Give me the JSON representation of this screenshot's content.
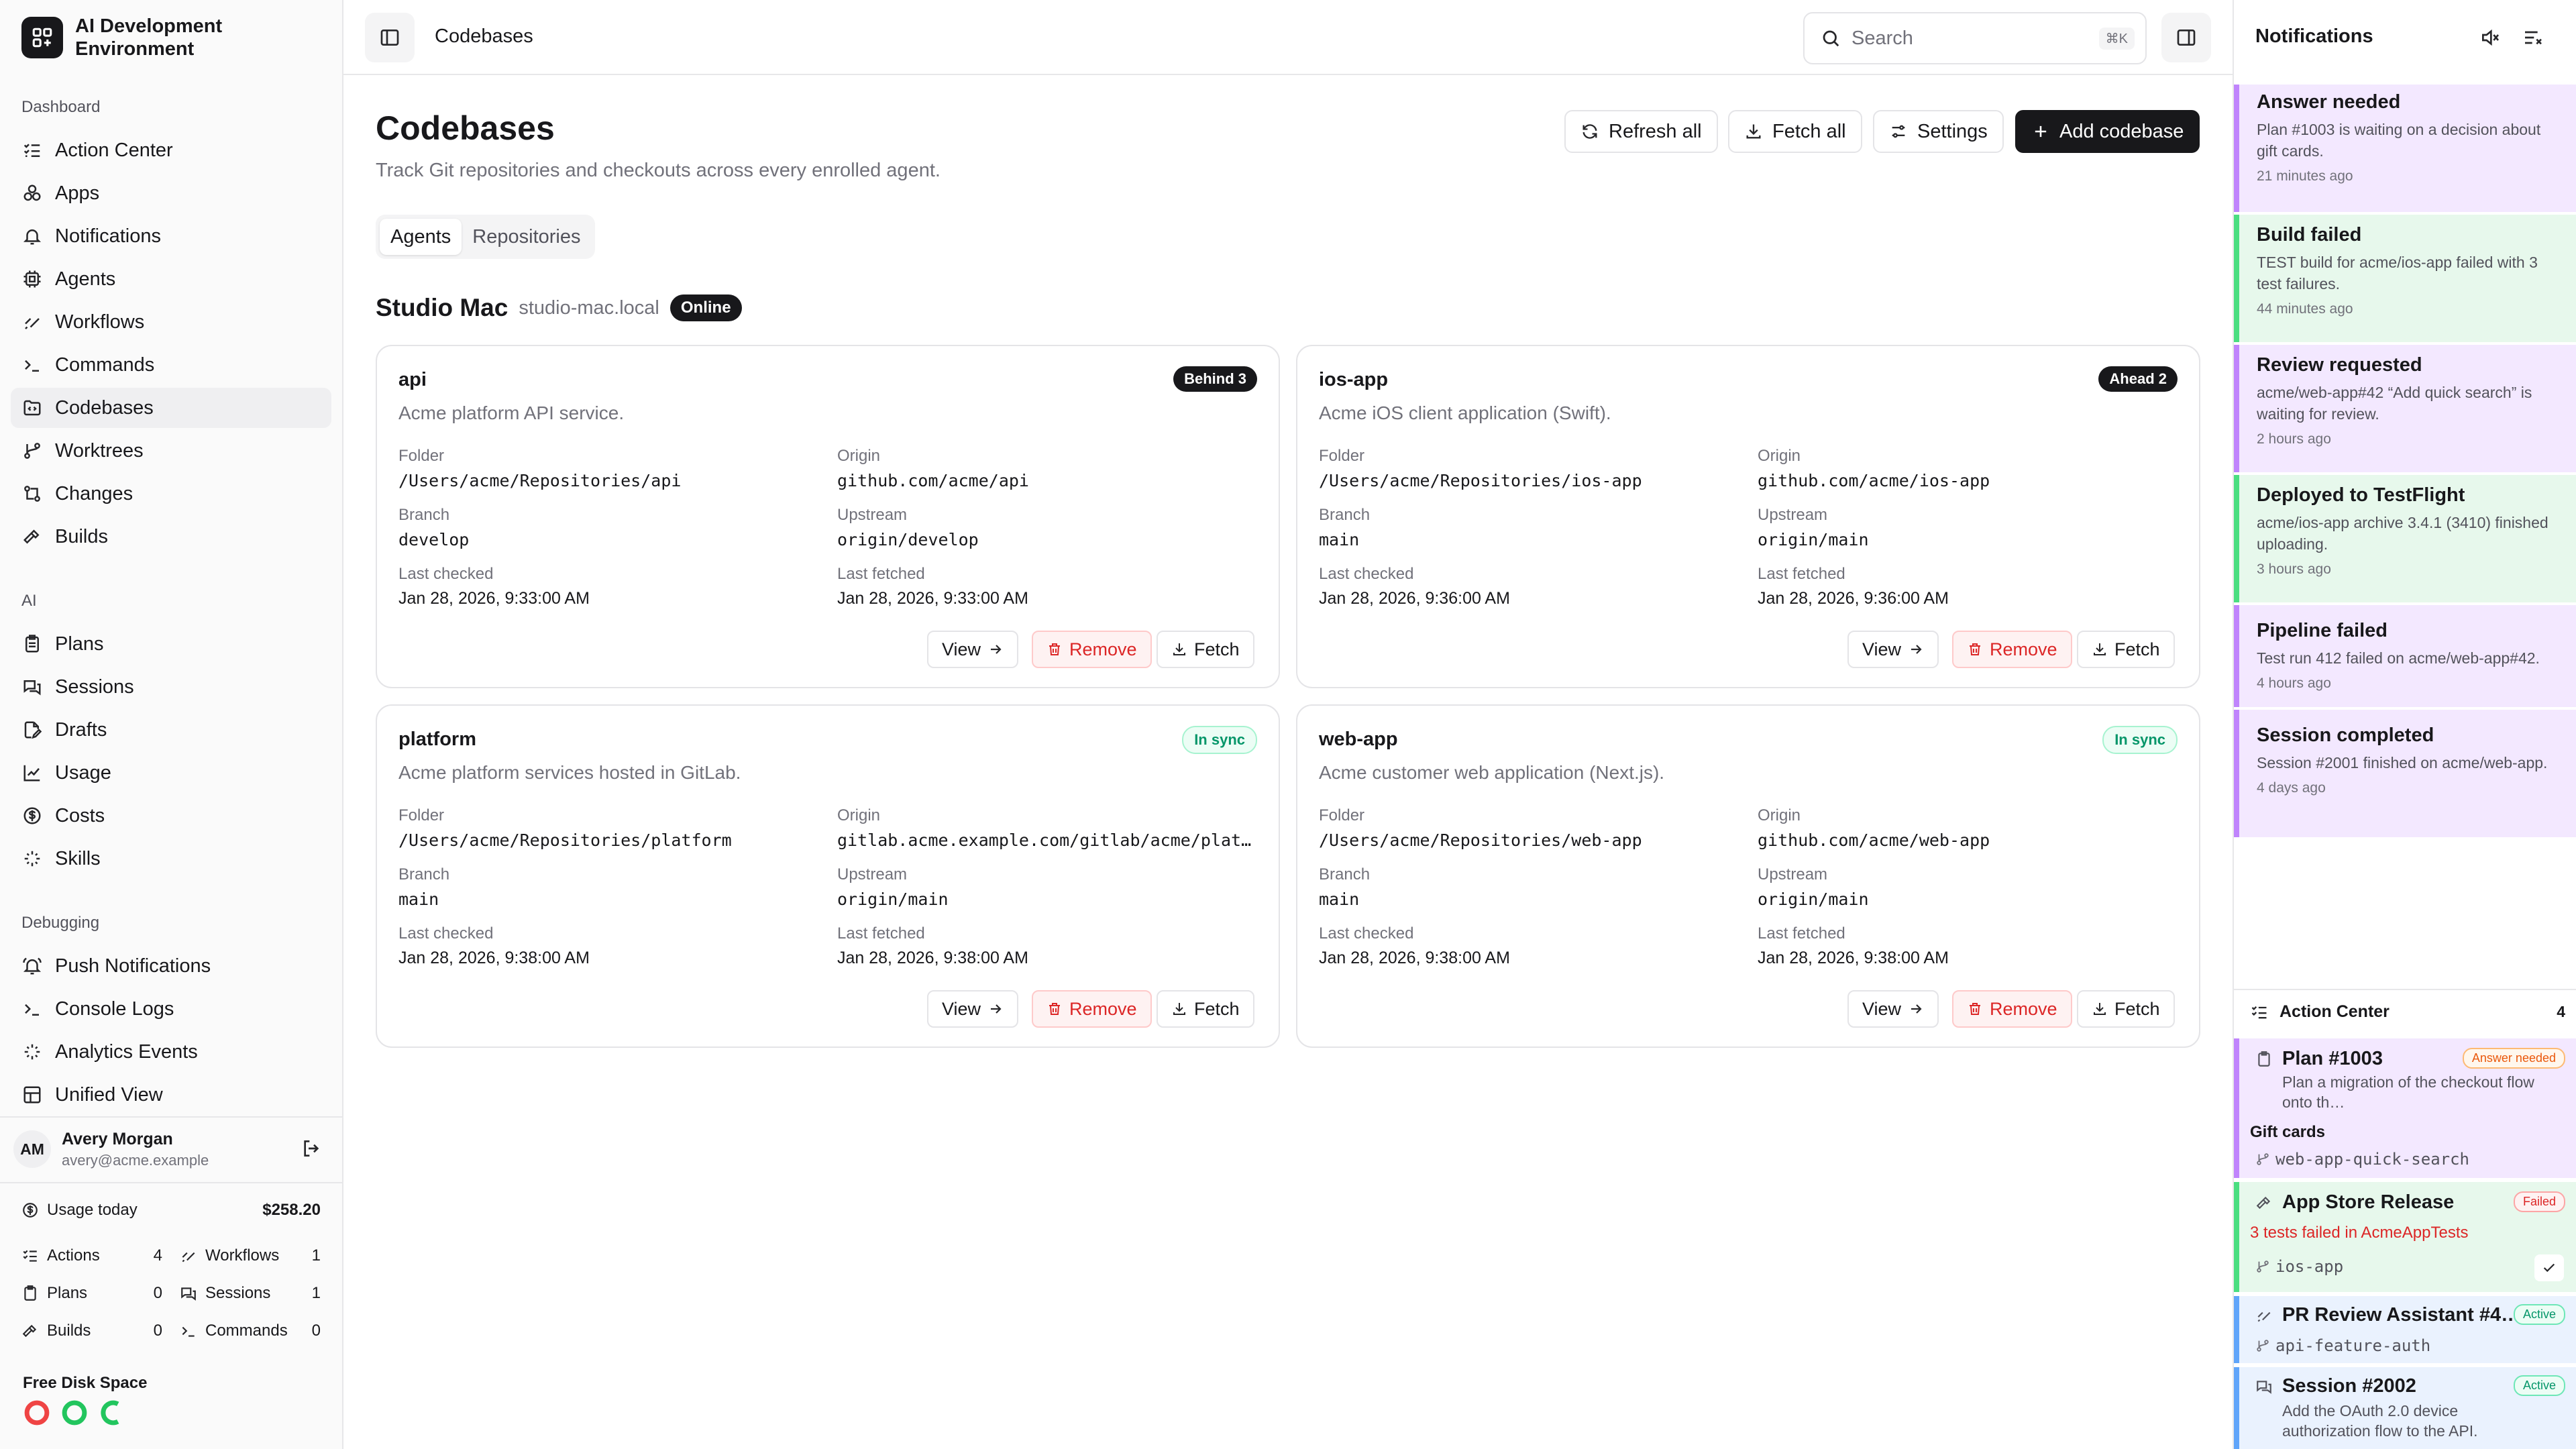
{
  "app": {
    "name": "AI Development Environment"
  },
  "sidebar": {
    "sections": {
      "dashboard": "Dashboard",
      "ai": "AI",
      "debugging": "Debugging"
    },
    "dashboard_items": [
      {
        "label": "Action Center",
        "icon": "list-checks-icon"
      },
      {
        "label": "Apps",
        "icon": "apps-icon"
      },
      {
        "label": "Notifications",
        "icon": "bell-icon"
      },
      {
        "label": "Agents",
        "icon": "cpu-icon"
      },
      {
        "label": "Workflows",
        "icon": "workflow-icon"
      },
      {
        "label": "Commands",
        "icon": "terminal-icon"
      },
      {
        "label": "Codebases",
        "icon": "folder-code-icon"
      },
      {
        "label": "Worktrees",
        "icon": "git-branch-icon"
      },
      {
        "label": "Changes",
        "icon": "git-compare-icon"
      },
      {
        "label": "Builds",
        "icon": "hammer-icon"
      }
    ],
    "ai_items": [
      {
        "label": "Plans",
        "icon": "clipboard-icon"
      },
      {
        "label": "Sessions",
        "icon": "chat-icon"
      },
      {
        "label": "Drafts",
        "icon": "file-edit-icon"
      },
      {
        "label": "Usage",
        "icon": "chart-icon"
      },
      {
        "label": "Costs",
        "icon": "dollar-icon"
      },
      {
        "label": "Skills",
        "icon": "sparkles-icon"
      }
    ],
    "debug_items": [
      {
        "label": "Push Notifications",
        "icon": "bell-ring-icon"
      },
      {
        "label": "Console Logs",
        "icon": "terminal-icon"
      },
      {
        "label": "Analytics Events",
        "icon": "sparkles-icon"
      },
      {
        "label": "Unified View",
        "icon": "layout-icon"
      }
    ],
    "user": {
      "initials": "AM",
      "name": "Avery Morgan",
      "email": "avery@acme.example"
    },
    "usage": {
      "label": "Usage today",
      "value": "$258.20"
    },
    "stats": [
      {
        "label": "Actions",
        "value": "4"
      },
      {
        "label": "Workflows",
        "value": "1"
      },
      {
        "label": "Plans",
        "value": "0"
      },
      {
        "label": "Sessions",
        "value": "1"
      },
      {
        "label": "Builds",
        "value": "0"
      },
      {
        "label": "Commands",
        "value": "0"
      }
    ],
    "disk": {
      "label": "Free Disk Space"
    }
  },
  "topbar": {
    "breadcrumb": "Codebases",
    "search_placeholder": "Search",
    "search_shortcut": "⌘K"
  },
  "page": {
    "title": "Codebases",
    "subtitle": "Track Git repositories and checkouts across every enrolled agent.",
    "actions": {
      "refresh": "Refresh all",
      "fetch": "Fetch all",
      "settings": "Settings",
      "add": "Add codebase"
    },
    "tabs": [
      "Agents",
      "Repositories"
    ],
    "agent": {
      "name": "Studio Mac",
      "host": "studio-mac.local",
      "status": "Online"
    }
  },
  "labels": {
    "folder": "Folder",
    "origin": "Origin",
    "branch": "Branch",
    "upstream": "Upstream",
    "last_checked": "Last checked",
    "last_fetched": "Last fetched",
    "view": "View",
    "remove": "Remove",
    "fetch": "Fetch"
  },
  "codebases": [
    {
      "name": "api",
      "description": "Acme platform API service.",
      "status": "Behind 3",
      "folder": "/Users/acme/Repositories/api",
      "origin": "github.com/acme/api",
      "branch": "develop",
      "upstream": "origin/develop",
      "last_checked": "Jan 28, 2026, 9:33:00 AM",
      "last_fetched": "Jan 28, 2026, 9:33:00 AM"
    },
    {
      "name": "ios-app",
      "description": "Acme iOS client application (Swift).",
      "status": "Ahead 2",
      "folder": "/Users/acme/Repositories/ios-app",
      "origin": "github.com/acme/ios-app",
      "branch": "main",
      "upstream": "origin/main",
      "last_checked": "Jan 28, 2026, 9:36:00 AM",
      "last_fetched": "Jan 28, 2026, 9:36:00 AM"
    },
    {
      "name": "platform",
      "description": "Acme platform services hosted in GitLab.",
      "status": "In sync",
      "folder": "/Users/acme/Repositories/platform",
      "origin": "gitlab.acme.example.com/gitlab/acme/platform",
      "branch": "main",
      "upstream": "origin/main",
      "last_checked": "Jan 28, 2026, 9:38:00 AM",
      "last_fetched": "Jan 28, 2026, 9:38:00 AM"
    },
    {
      "name": "web-app",
      "description": "Acme customer web application (Next.js).",
      "status": "In sync",
      "folder": "/Users/acme/Repositories/web-app",
      "origin": "github.com/acme/web-app",
      "branch": "main",
      "upstream": "origin/main",
      "last_checked": "Jan 28, 2026, 9:38:00 AM",
      "last_fetched": "Jan 28, 2026, 9:38:00 AM"
    }
  ],
  "notifications": {
    "title": "Notifications",
    "items": [
      {
        "title": "Answer needed",
        "body": "Plan #1003 is waiting on a decision about gift cards.",
        "time": "21 minutes ago",
        "color": "#c084fc",
        "bg": "#f3e8ff"
      },
      {
        "title": "Build failed",
        "body": "TEST build for acme/ios-app failed with 3 test failures.",
        "time": "44 minutes ago",
        "color": "#4ade80",
        "bg": "#e7f8ec"
      },
      {
        "title": "Review requested",
        "body": "acme/web-app#42 “Add quick search” is waiting for review.",
        "time": "2 hours ago",
        "color": "#c084fc",
        "bg": "#f3e8ff"
      },
      {
        "title": "Deployed to TestFlight",
        "body": "acme/ios-app archive 3.4.1 (3410) finished uploading.",
        "time": "3 hours ago",
        "color": "#4ade80",
        "bg": "#e7f8ec"
      },
      {
        "title": "Pipeline failed",
        "body": "Test run 412 failed on acme/web-app#42.",
        "time": "4 hours ago",
        "color": "#c084fc",
        "bg": "#f3e8ff"
      },
      {
        "title": "Session completed",
        "body": "Session #2001 finished on acme/web-app.",
        "time": "4 days ago",
        "color": "#c084fc",
        "bg": "#f3e8ff"
      }
    ]
  },
  "action_center": {
    "title": "Action Center",
    "count": "4",
    "items": [
      {
        "title": "Plan #1003",
        "badge": "Answer needed",
        "sub": "Plan a migration of the checkout flow onto th…",
        "extra": "Gift cards",
        "branch": "web-app-quick-search",
        "color": "#c084fc",
        "bg": "#f3e8ff"
      },
      {
        "title": "App Store Release",
        "badge": "Failed",
        "sub": "3 tests failed in AcmeAppTests",
        "branch": "ios-app",
        "color": "#4ade80",
        "bg": "#e7f8ec"
      },
      {
        "title": "PR Review Assistant #4…",
        "badge": "Active",
        "branch": "api-feature-auth",
        "color": "#60a5fa",
        "bg": "#eaf2fe"
      },
      {
        "title": "Session #2002",
        "badge": "Active",
        "sub": "Add the OAuth 2.0 device authorization flow to the API.",
        "color": "#60a5fa",
        "bg": "#eaf2fe"
      }
    ]
  }
}
